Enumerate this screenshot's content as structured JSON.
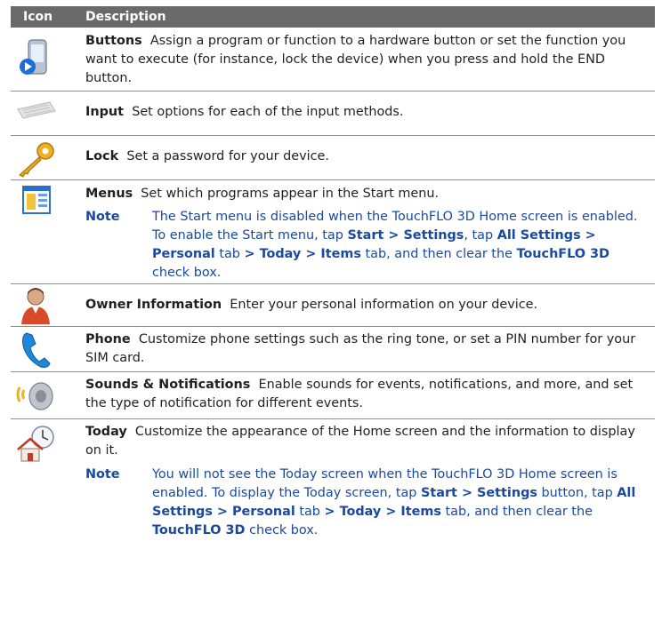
{
  "header": {
    "icon": "Icon",
    "description": "Description"
  },
  "rows": [
    {
      "icon": "buttons-phone-icon",
      "title": "Buttons",
      "text": "Assign a program or function to a hardware button or set the function you want to execute (for instance, lock the device) when you press and hold the END button."
    },
    {
      "icon": "keyboard-icon",
      "title": "Input",
      "text": "Set options for each of the input methods."
    },
    {
      "icon": "key-icon",
      "title": "Lock",
      "text": "Set a password for your device."
    },
    {
      "icon": "menu-window-icon",
      "title": "Menus",
      "text": "Set which programs appear in the Start menu.",
      "note": {
        "label": "Note",
        "t1": "The Start menu is disabled when the TouchFLO 3D Home screen is enabled. To enable the Start menu, tap ",
        "b1": "Start > Settings",
        "t2": ", tap ",
        "b2": "All Settings > Personal",
        "t3": " tab ",
        "b3": "> Today > Items",
        "t4": " tab, and then clear the ",
        "b4": "TouchFLO 3D",
        "t5": " check box."
      }
    },
    {
      "icon": "owner-person-icon",
      "title": "Owner Information",
      "text": "Enter your personal information on your device."
    },
    {
      "icon": "phone-handset-icon",
      "title": "Phone",
      "text": "Customize phone settings such as the ring tone, or set a PIN number for your SIM card."
    },
    {
      "icon": "speaker-sound-icon",
      "title": "Sounds & Notifications",
      "text": "Enable sounds for events, notifications, and more, and set the type of notification for different events."
    },
    {
      "icon": "home-clock-icon",
      "title": "Today",
      "text": "Customize the appearance of the Home screen and the information to display on it.",
      "note": {
        "label": "Note",
        "t1": "You will not see the Today screen when the TouchFLO 3D Home screen is enabled. To display the Today screen, tap ",
        "b1": "Start > Settings",
        "t2": " button, tap ",
        "b2": "All Settings > Personal",
        "t3": " tab ",
        "b3": "> Today > Items",
        "t4": " tab, and then clear the ",
        "b4": "TouchFLO 3D",
        "t5": " check box."
      }
    }
  ],
  "colors": {
    "header_bg": "#6a6a6a",
    "note_text": "#1a4aa0",
    "separator": "#8e8e8e"
  }
}
